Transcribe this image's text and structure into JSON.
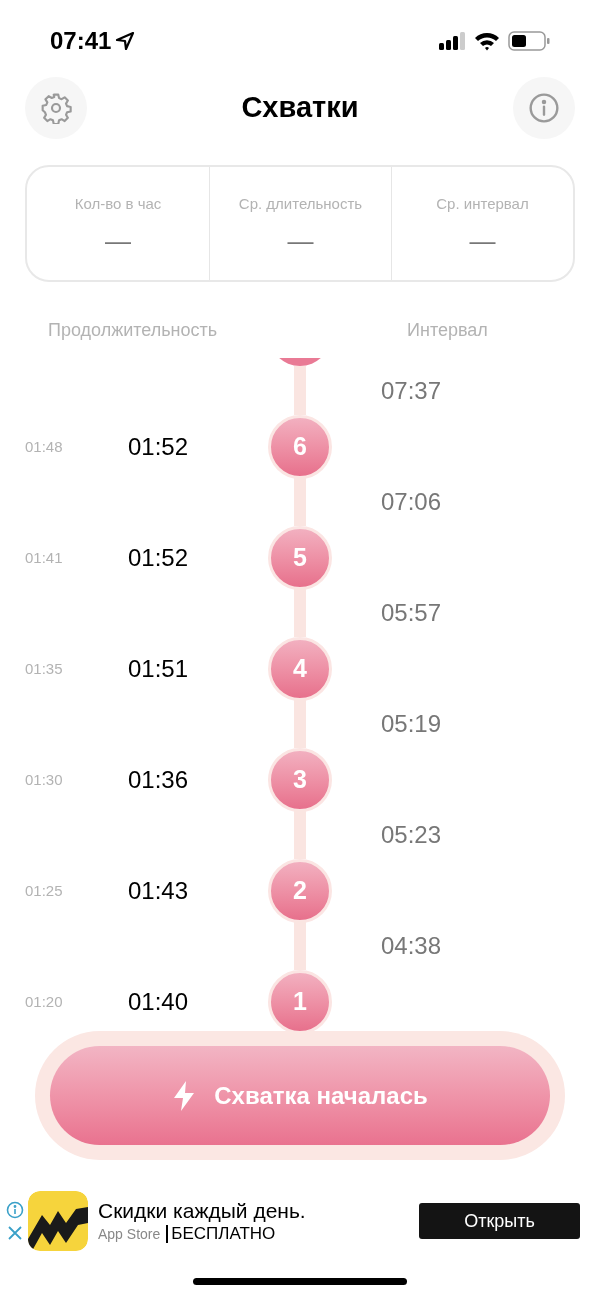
{
  "status_bar": {
    "time": "07:41"
  },
  "header": {
    "title": "Схватки"
  },
  "stats": [
    {
      "label": "Кол-во в час",
      "value": "—"
    },
    {
      "label": "Ср. длительность",
      "value": "—"
    },
    {
      "label": "Ср. интервал",
      "value": "—"
    }
  ],
  "columns": [
    "Продолжительность",
    "Интервал"
  ],
  "contractions": [
    {
      "interval": "07:37",
      "start": "01:48",
      "duration": "01:52",
      "number": "6"
    },
    {
      "interval": "07:06",
      "start": "01:41",
      "duration": "01:52",
      "number": "5"
    },
    {
      "interval": "05:57",
      "start": "01:35",
      "duration": "01:51",
      "number": "4"
    },
    {
      "interval": "05:19",
      "start": "01:30",
      "duration": "01:36",
      "number": "3"
    },
    {
      "interval": "05:23",
      "start": "01:25",
      "duration": "01:43",
      "number": "2"
    },
    {
      "interval": "04:38",
      "start": "01:20",
      "duration": "01:40",
      "number": "1"
    }
  ],
  "start_button": {
    "label": "Схватка началась"
  },
  "ad": {
    "title": "Скидки каждый день.",
    "store": "App Store",
    "price": "БЕСПЛАТНО",
    "button": "Открыть"
  }
}
